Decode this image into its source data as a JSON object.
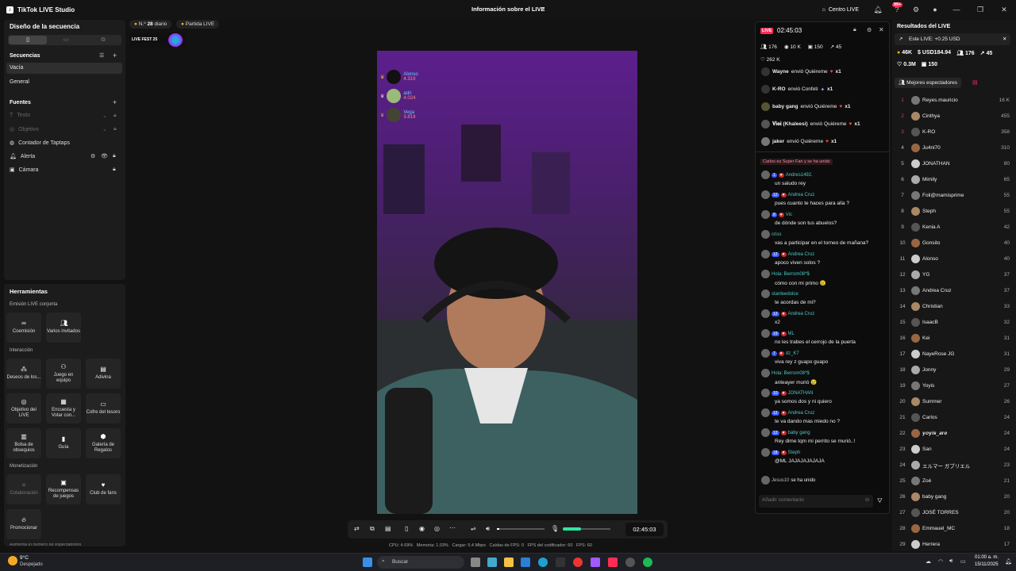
{
  "app": {
    "title": "TikTok LIVE Studio",
    "center_title": "Información sobre el LIVE",
    "centro_live": "Centro LIVE",
    "notif_badge": "99+"
  },
  "left": {
    "heading": "Diseño de la secuencia",
    "sequences_label": "Secuencias",
    "scenes": [
      "Vacía",
      "General"
    ],
    "sources_label": "Fuentes",
    "sources": [
      {
        "label": "Texto",
        "disabled": true
      },
      {
        "label": "Objetivo",
        "disabled": true
      },
      {
        "label": "Contador de Taptaps",
        "disabled": false
      },
      {
        "label": "Alerta",
        "disabled": false
      },
      {
        "label": "Cámara",
        "disabled": false
      }
    ],
    "tools_heading": "Herramientas",
    "sections": [
      "Emisión LIVE conjunta",
      "Interacción",
      "Monetización"
    ],
    "tools_colab": [
      "Coemisión",
      "Varios invitados"
    ],
    "tools_inter": [
      "Deseos de los...",
      "Juego en equipo",
      "Adivina",
      "Objetivo del LIVE",
      "Encuesta y Votar con...",
      "Cofre del tesoro",
      "Bolsa de obsequios",
      "Guía",
      "Galería de Regalos"
    ],
    "tools_mon": [
      "Colaboración",
      "Recompensas de juegos",
      "Club de fans",
      "Promocionar"
    ],
    "footer_cut": "Aumenta el número de espectadores"
  },
  "overlay": {
    "daily_prefix": "N.º",
    "daily_num": "28",
    "daily_suffix": "diario",
    "match": "Partida LIVE",
    "fest": "LIVE FEST 25",
    "top": [
      {
        "name": "Alonso",
        "score": "4.319"
      },
      {
        "name": "adri",
        "score": "4.024"
      },
      {
        "name": "Vega",
        "score": "3.819"
      }
    ]
  },
  "chat": {
    "live_badge": "LIVE",
    "timer": "02:45:03",
    "stats": [
      {
        "icon": "people-icon",
        "value": "176"
      },
      {
        "icon": "eye-icon",
        "value": "10 K"
      },
      {
        "icon": "gift-icon",
        "value": "150"
      },
      {
        "icon": "share-icon",
        "value": "45"
      }
    ],
    "likes": "262 K",
    "gifts": [
      {
        "user": "Wayne",
        "action": "envió Quiéreme",
        "count": "x1"
      },
      {
        "user": "K-RO",
        "action": "envió Confeti",
        "count": "x1"
      },
      {
        "user": "baby gang",
        "action": "envió Quiéreme",
        "count": "x1"
      },
      {
        "user": "𝐕𝐢𝐞𝐢 (Khaleesi)",
        "action": "envió Quiéreme",
        "count": "x1"
      },
      {
        "user": "jaker",
        "action": "envió Quiéreme",
        "count": "x1"
      }
    ],
    "superfan": "Carlos es Super Fan y se ha unido",
    "messages": [
      {
        "lvl": "1",
        "user": "Andres1492.",
        "text": "un saludo rey"
      },
      {
        "lvl": "12",
        "user": "Andrea Cruz",
        "text": "pues cuanto te haces para alla ?"
      },
      {
        "lvl": "8",
        "user": "Vic",
        "text": "de dónde son tus abuelos?"
      },
      {
        "lvl": "",
        "user": "criss",
        "text": "vas a participar en el torneo de mañana?"
      },
      {
        "lvl": "12",
        "user": "Andrea Cruz",
        "text": "apoco viven solos ?"
      },
      {
        "lvl": "",
        "user": "Hola: Berrom08*$",
        "text": "cómo con mi primo 😢"
      },
      {
        "lvl": "",
        "user": "stanleedolce",
        "text": "te acordas de mi?"
      },
      {
        "lvl": "12",
        "user": "Andrea Cruz",
        "text": "x2"
      },
      {
        "lvl": "19",
        "user": "ML",
        "text": "no les trabes el cerrojo de la puerta"
      },
      {
        "lvl": "7",
        "user": "dz_K7",
        "text": "viva rey z guapo guapo"
      },
      {
        "lvl": "",
        "user": "Hola: Berrom08*$",
        "text": "anteayer murió 😢"
      },
      {
        "lvl": "10",
        "user": "JONATHAN",
        "text": "ya somos dos y ni quiero"
      },
      {
        "lvl": "12",
        "user": "Andrea Cruz",
        "text": "te va dando mas miedo no ?"
      },
      {
        "lvl": "12",
        "user": "baby gang",
        "text": "Rey dime tqm mi perrito se murió..!"
      },
      {
        "lvl": "18",
        "user": "Steph",
        "text": "@ML JAJAJAJAJAJA"
      }
    ],
    "joined_user": "Jesus10",
    "joined_text": "se ha unido",
    "input_placeholder": "Añadir comentario"
  },
  "results": {
    "heading": "Resultados del LIVE",
    "earnings": "Este LIVE: +0.25 USD",
    "stats1": [
      "46K",
      "USD184.94",
      "176",
      "45"
    ],
    "stats2": [
      "0.3M",
      "150"
    ],
    "best": "Mejores espectadores",
    "ranking": [
      [
        "1",
        "Reyes.mauricio",
        "16 K"
      ],
      [
        "2",
        "Cinthya",
        "455"
      ],
      [
        "3",
        "K-RO",
        "358"
      ],
      [
        "4",
        "Ju4nl70",
        "310"
      ],
      [
        "5",
        "JONATHAN",
        "80"
      ],
      [
        "6",
        "Mimily",
        "65"
      ],
      [
        "7",
        "Foli@mamisprime",
        "55"
      ],
      [
        "8",
        "Steph",
        "55"
      ],
      [
        "9",
        "Kenia A",
        "42"
      ],
      [
        "10",
        "Gonsito",
        "40"
      ],
      [
        "11",
        "Alonso",
        "40"
      ],
      [
        "12",
        "YG",
        "37"
      ],
      [
        "13",
        "Andrea Cruz",
        "37"
      ],
      [
        "14",
        "Christian",
        "33"
      ],
      [
        "15",
        "IsaacB",
        "32"
      ],
      [
        "16",
        "Kei",
        "31"
      ],
      [
        "17",
        "NayeRose JG",
        "31"
      ],
      [
        "18",
        "Jonny",
        "29"
      ],
      [
        "19",
        "Yoyis",
        "27"
      ],
      [
        "20",
        "Summer",
        "26"
      ],
      [
        "21",
        "Carlos",
        "24"
      ],
      [
        "22",
        "𝒚𝒐𝒚𝒊𝒔_𝒂𝒓𝒆",
        "24"
      ],
      [
        "23",
        "San",
        "24"
      ],
      [
        "24",
        "エルマー ガブリエル",
        "23"
      ],
      [
        "25",
        "Zoé",
        "21"
      ],
      [
        "26",
        "baby gang",
        "20"
      ],
      [
        "27",
        "JOSÉ TORRES",
        "20"
      ],
      [
        "28",
        "Emmauel_MC",
        "18"
      ],
      [
        "29",
        "Herrera",
        "17"
      ]
    ]
  },
  "controls": {
    "timer": "02:45:03"
  },
  "stats_line": "CPU: 4.69%   Memoria: 1.03%   Cargar: 5.4 Mbps   Caídas de FPS: 0   FPS del codificador: 60   FPS: 60",
  "taskbar": {
    "temp": "9°C",
    "weather": "Despejado",
    "search": "Buscar",
    "time": "01:00 a. m.",
    "date": "15/11/2025"
  },
  "colors": {
    "accent": "#fe2c55",
    "teal": "#4fc6c3",
    "stage_purple": "#5c1f8c"
  }
}
